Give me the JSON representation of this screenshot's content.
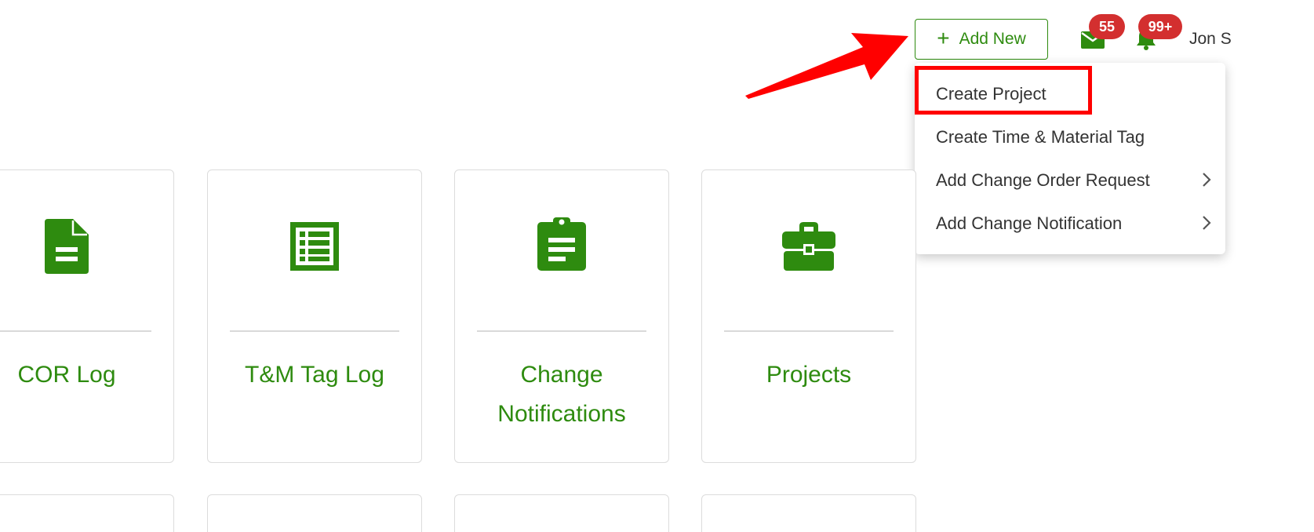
{
  "header": {
    "add_new_label": "Add New",
    "plus_icon": "plus-icon",
    "mail_icon": "mail-icon",
    "mail_badge": "55",
    "bell_icon": "bell-icon",
    "notification_badge": "99+",
    "user_name": "Jon S"
  },
  "dropdown": {
    "items": [
      {
        "label": "Create Project"
      },
      {
        "label": "Create Time & Material Tag"
      },
      {
        "label": "Add Change Order Request"
      },
      {
        "label": "Add Change Notification"
      }
    ]
  },
  "cards": [
    {
      "label": "COR Log",
      "icon": "document-icon"
    },
    {
      "label": "T&M Tag Log",
      "icon": "list-sheet-icon"
    },
    {
      "label": "Change Notifications",
      "icon": "clipboard-icon"
    },
    {
      "label": "Projects",
      "icon": "briefcase-icon"
    }
  ],
  "colors": {
    "brand_green": "#2e8b0f",
    "badge_red": "#d32f2f",
    "annotation_red": "#ff0000"
  }
}
